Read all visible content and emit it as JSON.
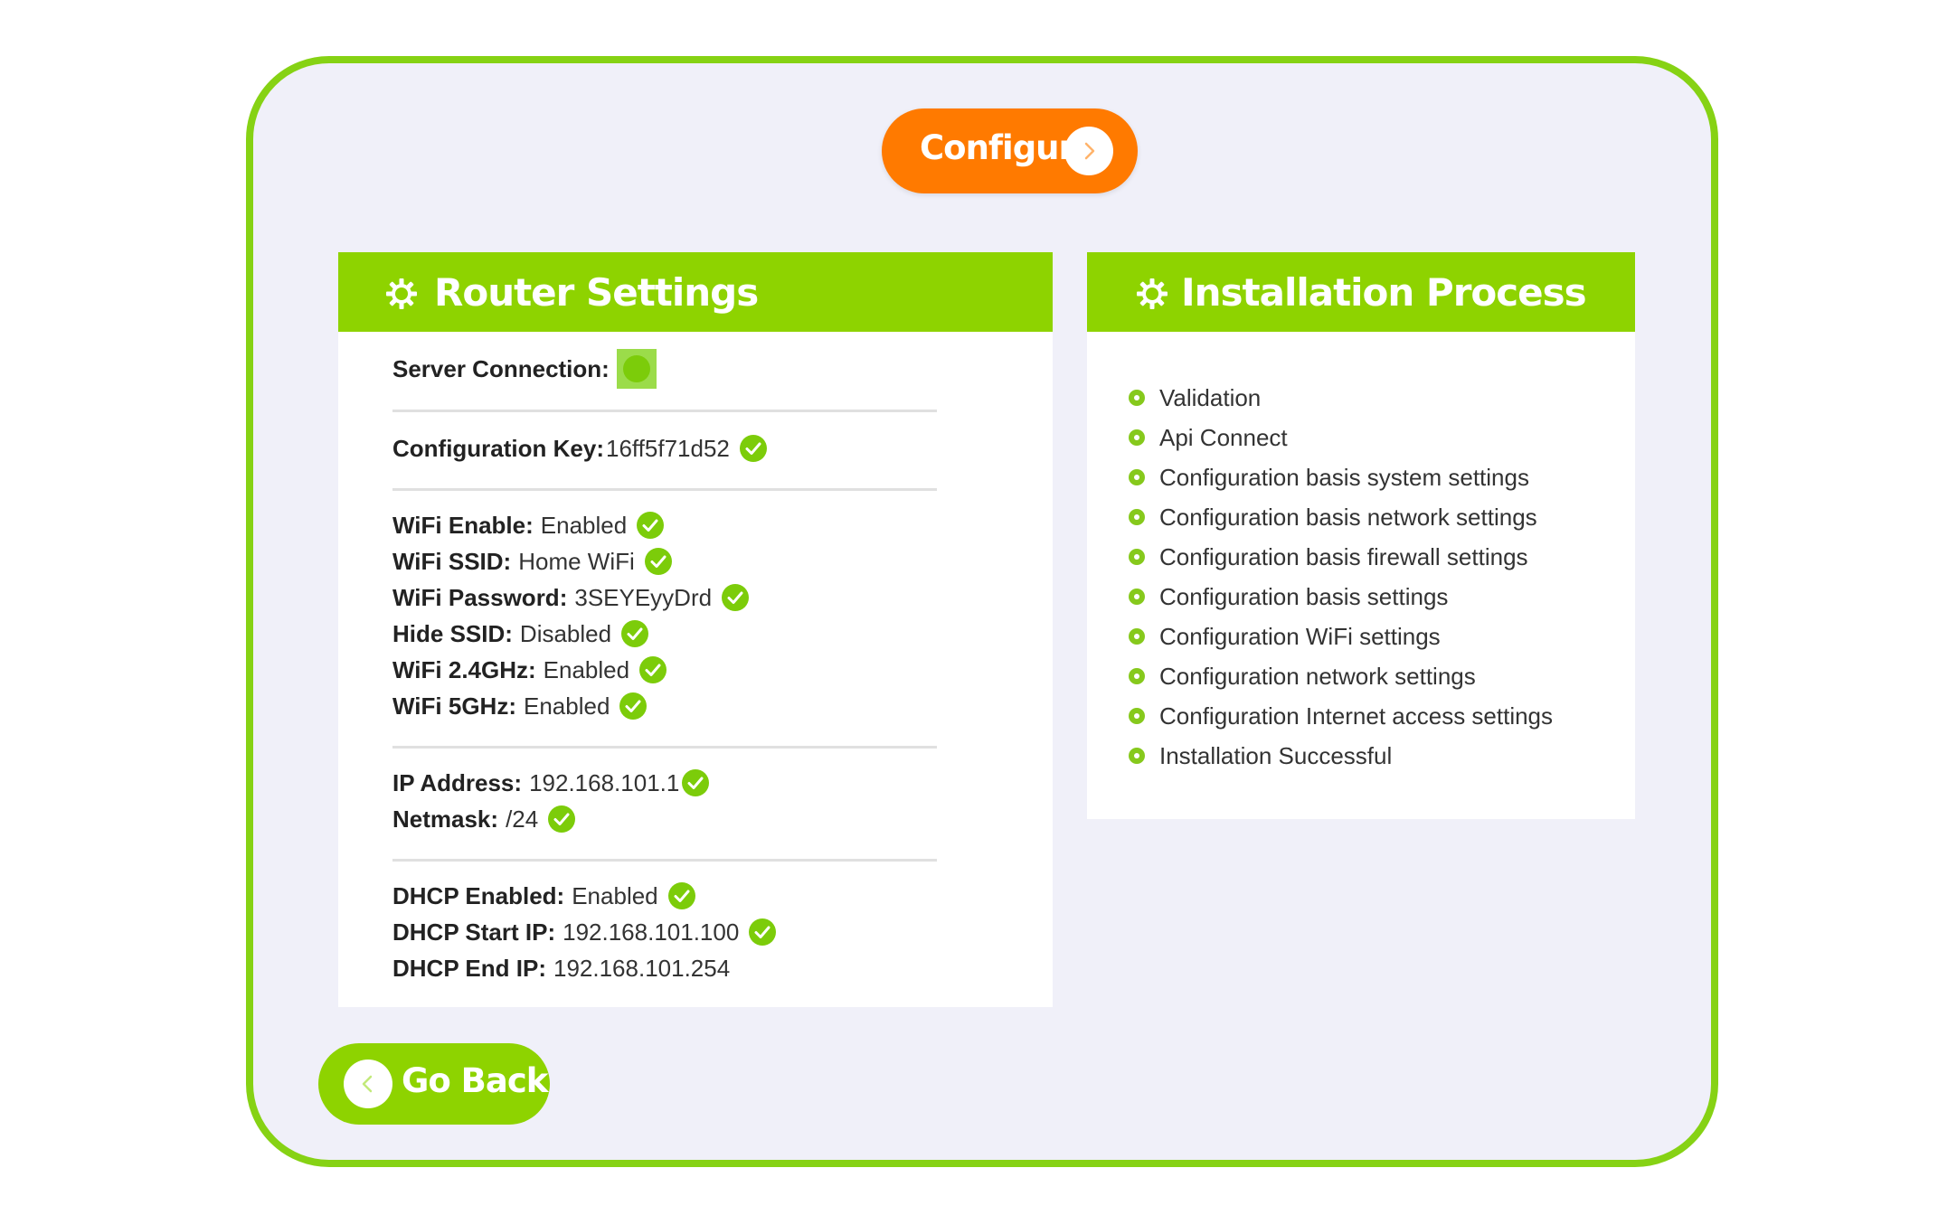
{
  "actions": {
    "configure_label": "Configure",
    "goback_label": "Go Back"
  },
  "colors": {
    "accent_green": "#8ed300",
    "accent_orange": "#ff7a00",
    "check_green": "#7ccc0a"
  },
  "router": {
    "title": "Router Settings",
    "server_connection_label": "Server Connection:",
    "config_key_label": "Configuration Key:",
    "config_key_value": "16ff5f71d52",
    "wifi": [
      {
        "label": "WiFi Enable:",
        "value": "Enabled"
      },
      {
        "label": "WiFi SSID:",
        "value": "Home WiFi"
      },
      {
        "label": "WiFi Password:",
        "value": "3SEYEyyDrd"
      },
      {
        "label": "Hide SSID:",
        "value": "Disabled"
      },
      {
        "label": "WiFi 2.4GHz:",
        "value": "Enabled"
      },
      {
        "label": "WiFi 5GHz:",
        "value": "Enabled"
      }
    ],
    "network": [
      {
        "label": "IP Address:",
        "value": "192.168.101.1"
      },
      {
        "label": "Netmask:",
        "value": "/24"
      }
    ],
    "dhcp": [
      {
        "label": "DHCP Enabled:",
        "value": "Enabled"
      },
      {
        "label": "DHCP Start IP:",
        "value": "192.168.101.100"
      },
      {
        "label": "DHCP End IP:",
        "value": "192.168.101.254"
      }
    ]
  },
  "install": {
    "title": "Installation Process",
    "steps": [
      "Validation",
      "Api Connect",
      "Configuration basis system settings",
      "Configuration basis network settings",
      "Configuration basis firewall settings",
      "Configuration basis settings",
      "Configuration WiFi settings",
      "Configuration network settings",
      "Configuration Internet access settings",
      "Installation Successful"
    ]
  },
  "icons": {
    "check": "check-circle-icon",
    "gear": "gear-icon",
    "next": "chevron-right-icon",
    "back": "chevron-left-icon",
    "bullet": "bullet-dot-icon"
  }
}
